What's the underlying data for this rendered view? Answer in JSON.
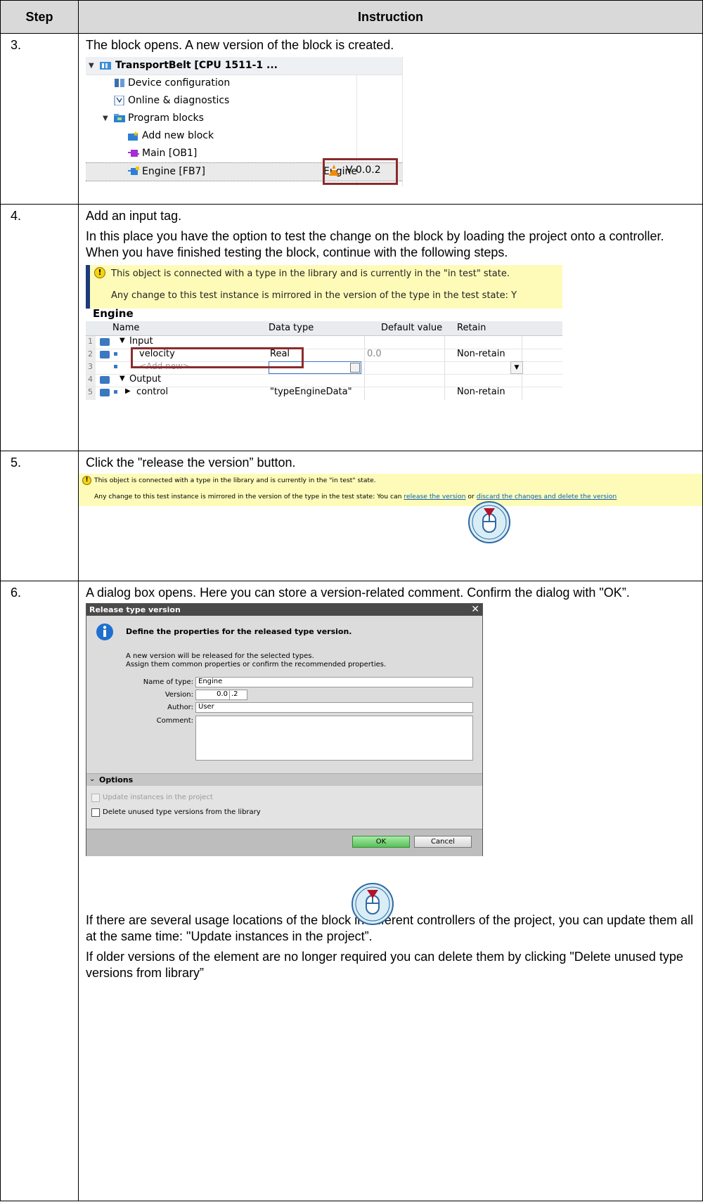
{
  "table": {
    "header_step": "Step",
    "header_instruction": "Instruction"
  },
  "step3": {
    "number": "3.",
    "text": "The block opens. A new version of the block is created.",
    "tree": {
      "root": "TransportBelt [CPU 1511-1 ...",
      "items": [
        "Device configuration",
        "Online & diagnostics",
        "Program blocks",
        "Add new block",
        "Main [OB1]",
        "Engine [FB7]"
      ],
      "engine_type": "Engine",
      "version": "V 0.0.2"
    }
  },
  "step4": {
    "number": "4.",
    "text1": "Add an input tag.",
    "text2": "In this place you have the option to test the change on the block by loading the project onto a controller. When you have finished testing the block, continue with the following steps.",
    "warn_line1": "This object is connected with a type in the library and is currently in the \"in test\" state.",
    "warn_line2": "Any change to this test instance is mirrored in the version of the type in the test state: Y",
    "block_title": "Engine",
    "columns": [
      "Name",
      "Data type",
      "Default value",
      "Retain"
    ],
    "rows": [
      {
        "num": "1",
        "name": "Input",
        "type": "",
        "default": "",
        "retain": ""
      },
      {
        "num": "2",
        "name": "velocity",
        "type": "Real",
        "default": "0.0",
        "retain": "Non-retain"
      },
      {
        "num": "3",
        "name": "<Add new>",
        "type": "",
        "default": "",
        "retain": ""
      },
      {
        "num": "4",
        "name": "Output",
        "type": "",
        "default": "",
        "retain": ""
      },
      {
        "num": "5",
        "name": "control",
        "type": "\"typeEngineData\"",
        "default": "",
        "retain": "Non-retain"
      }
    ]
  },
  "step5": {
    "number": "5.",
    "text": "Click the \"release the version” button.",
    "warn_line1": "This object is connected with a type in the library and is currently in the \"in test\" state.",
    "warn_line2_prefix": "Any change to this test instance is mirrored in the version of the type in the test state: You can",
    "link_release": "release the version",
    "or": "or",
    "link_discard": "discard the changes and delete the version"
  },
  "step6": {
    "number": "6.",
    "text": "A dialog box opens. Here you can store a version-related comment. Confirm the dialog with \"OK”.",
    "dialog": {
      "title": "Release type version",
      "heading": "Define the properties for the released type version.",
      "desc1": "A new version will be released for the selected types.",
      "desc2": "Assign them common properties or confirm the recommended properties.",
      "label_name": "Name of type:",
      "value_name": "Engine",
      "label_version": "Version:",
      "value_version_major": "0.0",
      "value_version_minor": ".2",
      "label_author": "Author:",
      "value_author": "User",
      "label_comment": "Comment:",
      "options": "Options",
      "opt_update": "Update instances in the project",
      "opt_delete": "Delete unused type versions from the library",
      "ok": "OK",
      "cancel": "Cancel"
    },
    "text_after1": "If there are several usage locations of the block in different controllers of the project, you can update them all at the same time: \"Update instances in the project”.",
    "text_after2": "If older versions of the element are no longer required you can delete them by clicking \"Delete unused type versions from library”"
  },
  "colors": {
    "header_bg": "#d9d9d9",
    "highlight": "#8b2c2c",
    "warning_bg": "#fefbb8",
    "dialog_title_bg": "#4a4a4a",
    "dialog_bg": "#dcdcdc",
    "ok_green": "#7ed87e"
  }
}
